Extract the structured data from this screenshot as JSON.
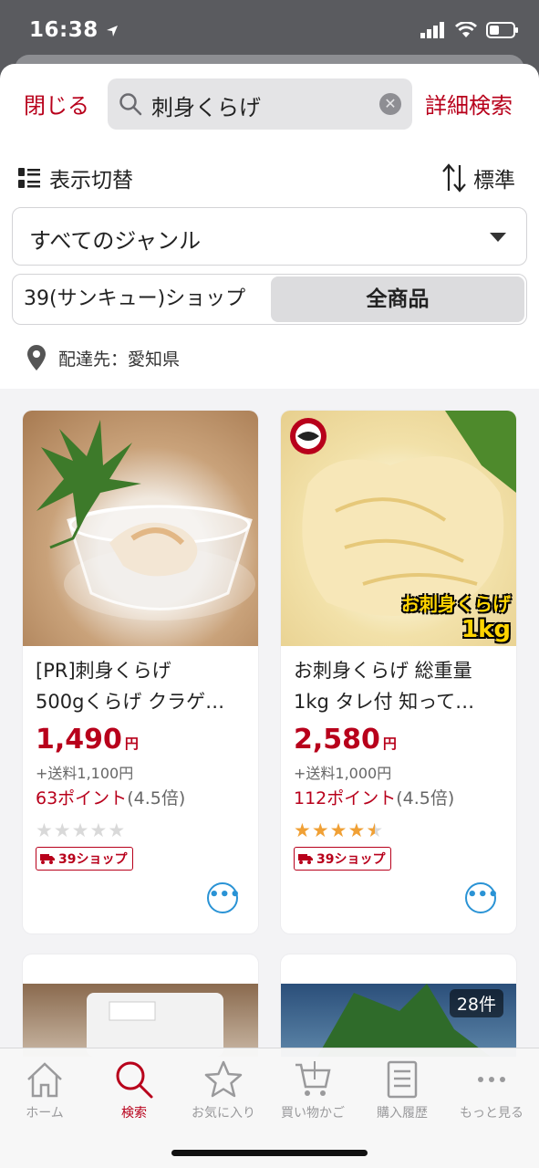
{
  "status_bar": {
    "time": "16:38"
  },
  "header": {
    "close_label": "閉じる",
    "search_query": "刺身くらげ",
    "detail_search_label": "詳細検索"
  },
  "toolbar": {
    "view_toggle_label": "表示切替",
    "sort_label": "標準"
  },
  "genre": {
    "selected": "すべてのジャンル"
  },
  "segment": {
    "shop_label": "39(サンキュー)ショップ",
    "all_label": "全商品"
  },
  "delivery": {
    "label": "配達先：愛知県"
  },
  "products": [
    {
      "title_line1": "[PR]刺身くらげ",
      "title_line2": "500gくらげ クラゲ…",
      "price": "1,490",
      "currency": "円",
      "shipping": "+送料1,100円",
      "points": "63ポイント",
      "multiplier": "(4.5倍)",
      "rating_stars": 0,
      "badge": "39ショップ"
    },
    {
      "title_line1": "お刺身くらげ 総重量",
      "title_line2": "1kg タレ付 知って…",
      "price": "2,580",
      "currency": "円",
      "shipping": "+送料1,000円",
      "points": "112ポイント",
      "multiplier": "(4.5倍)",
      "rating_stars": 4.5,
      "badge": "39ショップ",
      "image_text_line1": "お刺身くらげ",
      "image_text_line2": "1kg"
    }
  ],
  "card4": {
    "count": "28件"
  },
  "tabs": [
    {
      "label": "ホーム",
      "icon": "home-icon"
    },
    {
      "label": "検索",
      "icon": "search-icon"
    },
    {
      "label": "お気に入り",
      "icon": "star-icon"
    },
    {
      "label": "買い物かご",
      "icon": "cart-icon"
    },
    {
      "label": "購入履歴",
      "icon": "receipt-icon"
    },
    {
      "label": "もっと見る",
      "icon": "more-icon"
    }
  ],
  "colors": {
    "accent": "#b8001b",
    "star": "#f0a035",
    "link": "#2a93d5"
  }
}
